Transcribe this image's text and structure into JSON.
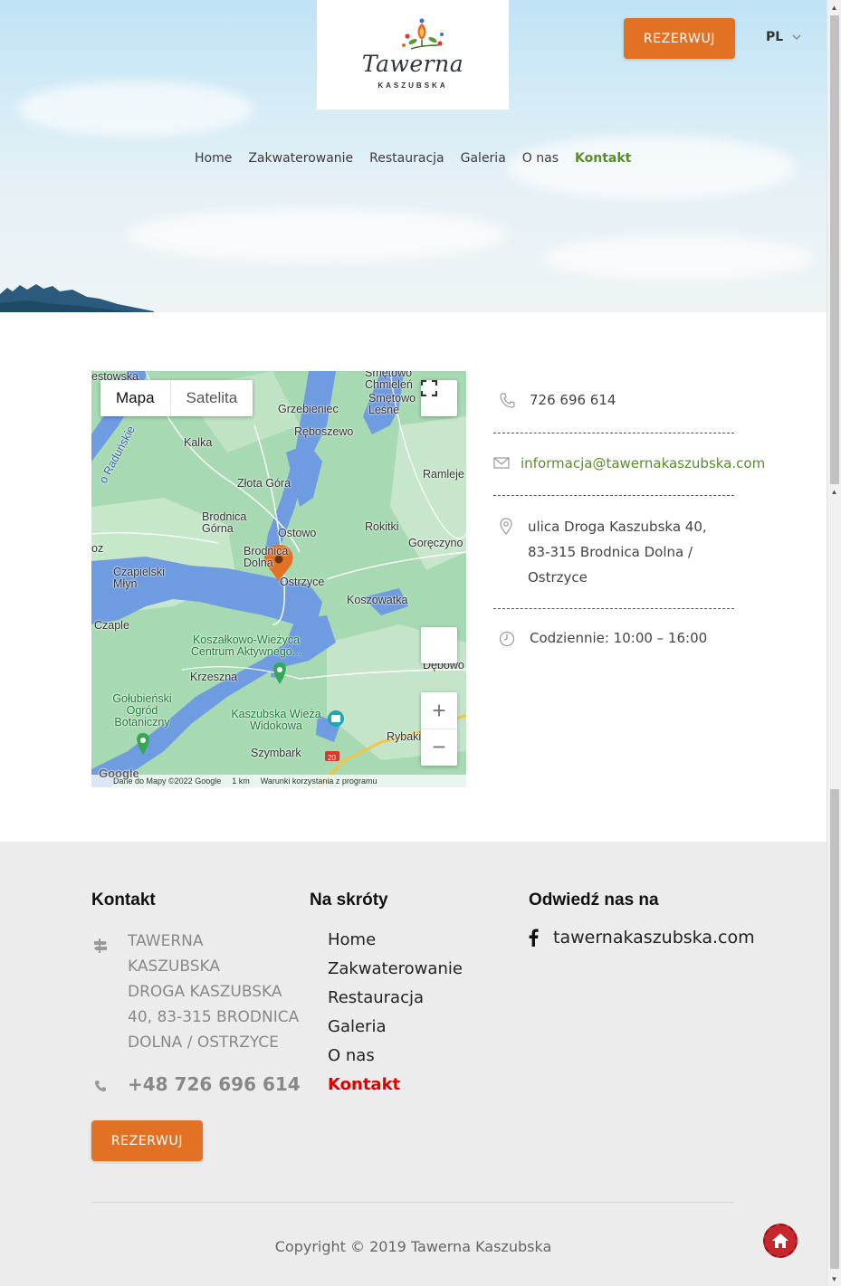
{
  "header": {
    "logo_name": "Tawerna",
    "logo_sub": "KASZUBSKA",
    "book_button": "REZERWUJ",
    "language": "PL"
  },
  "nav": {
    "items": [
      {
        "label": "Home",
        "active": false
      },
      {
        "label": "Zakwaterowanie",
        "active": false
      },
      {
        "label": "Restauracja",
        "active": false
      },
      {
        "label": "Galeria",
        "active": false
      },
      {
        "label": "O nas",
        "active": false
      },
      {
        "label": "Kontakt",
        "active": true
      }
    ],
    "accent_color": "#5b8b2e"
  },
  "map": {
    "tab_map": "Mapa",
    "tab_satellite": "Satelita",
    "attribution": "Dane do Mapy ©2022 Google",
    "scale": "1 km",
    "terms": "Warunki korzystania z programu",
    "logo": "Google",
    "labels": [
      "estowska",
      "Smętowo Chmieleń",
      "Smętowo Leśne",
      "Grzebieniec",
      "Ręboszewo",
      "Kalka",
      "Ramleje",
      "Złota Góra",
      "Brodnica Górna",
      "Ostowo",
      "Rokitki",
      "Goręczyno",
      "Brodnica Dolna",
      "Czapielski Młyn",
      "Ostrzyce",
      "Koszowatka",
      "Czaple",
      "Koszałkowo-Wieżyca Centrum Aktywnego...",
      "Krzeszna",
      "Dębowo",
      "Gołubieński Ogród Botaniczny",
      "Kaszubska Wieża Widokowa",
      "Rybaki",
      "Szymbark",
      "20",
      "oz",
      "o Raduńskie"
    ]
  },
  "contact": {
    "phone": "726 696 614",
    "email": "informacja@tawernakaszubska.com",
    "address_line1": "ulica Droga Kaszubska 40,",
    "address_line2": "83-315 Brodnica Dolna /",
    "address_line3": "Ostrzyce",
    "hours": "Codziennie: 10:00 – 16:00",
    "email_color": "#5b8b2e"
  },
  "footer": {
    "contact_heading": "Kontakt",
    "address_line1": "TAWERNA",
    "address_line2": "KASZUBSKA",
    "address_line3": "DROGA KASZUBSKA",
    "address_line4": "40, 83-315 BRODNICA",
    "address_line5": "DOLNA / OSTRZYCE",
    "phone": "+48 726 696 614",
    "book_button": "REZERWUJ",
    "shortcuts_heading": "Na skróty",
    "shortcuts": [
      {
        "label": "Home",
        "active": false
      },
      {
        "label": "Zakwaterowanie",
        "active": false
      },
      {
        "label": "Restauracja",
        "active": false
      },
      {
        "label": "Galeria",
        "active": false
      },
      {
        "label": "O nas",
        "active": false
      },
      {
        "label": "Kontakt",
        "active": true
      }
    ],
    "visit_heading": "Odwiedź nas na",
    "facebook": "tawernakaszubska.com",
    "copyright": "Copyright © 2019 Tawerna Kaszubska",
    "brand_color": "#e37124",
    "active_link_color": "#e10000"
  }
}
